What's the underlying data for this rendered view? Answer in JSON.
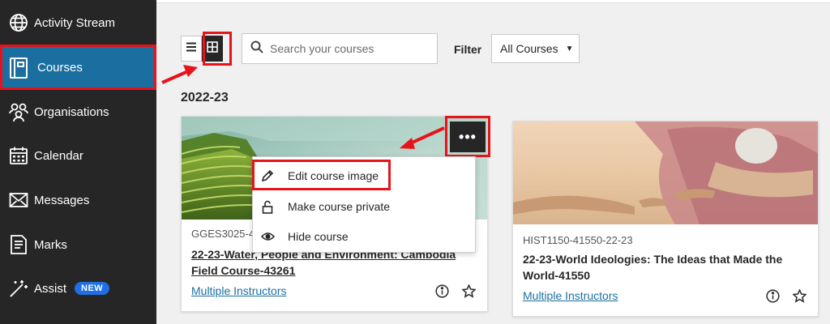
{
  "sidebar": {
    "items": [
      {
        "label": "Activity Stream",
        "icon": "globe-icon"
      },
      {
        "label": "Courses",
        "icon": "book-icon"
      },
      {
        "label": "Organisations",
        "icon": "people-icon"
      },
      {
        "label": "Calendar",
        "icon": "calendar-icon"
      },
      {
        "label": "Messages",
        "icon": "envelope-icon"
      },
      {
        "label": "Marks",
        "icon": "document-icon"
      },
      {
        "label": "Assist",
        "icon": "wand-icon",
        "badge": "NEW"
      }
    ]
  },
  "toolbar": {
    "search_placeholder": "Search your courses",
    "filter_label": "Filter",
    "filter_value": "All Courses"
  },
  "term": "2022-23",
  "courses": [
    {
      "code": "GGES3025-4",
      "title_line1": "22-23-Water, People and Environment: Cambodia",
      "title_line2": "Field Course-43261",
      "instructors": "Multiple Instructors"
    },
    {
      "code": "HIST1150-41550-22-23",
      "title_line1": "22-23-World Ideologies: The Ideas that Made the",
      "title_line2": "World-41550",
      "instructors": "Multiple Instructors"
    }
  ],
  "course_menu": {
    "more_label": "•••",
    "items": [
      {
        "label": "Edit course image",
        "icon": "pencil-icon"
      },
      {
        "label": "Make course private",
        "icon": "unlock-icon"
      },
      {
        "label": "Hide course",
        "icon": "eye-icon"
      }
    ]
  },
  "colors": {
    "sidebar_bg": "#262626",
    "active_bg": "#1a6fa0",
    "highlight": "#e8131a",
    "link": "#1a6fa0",
    "badge": "#1f6fe5"
  }
}
